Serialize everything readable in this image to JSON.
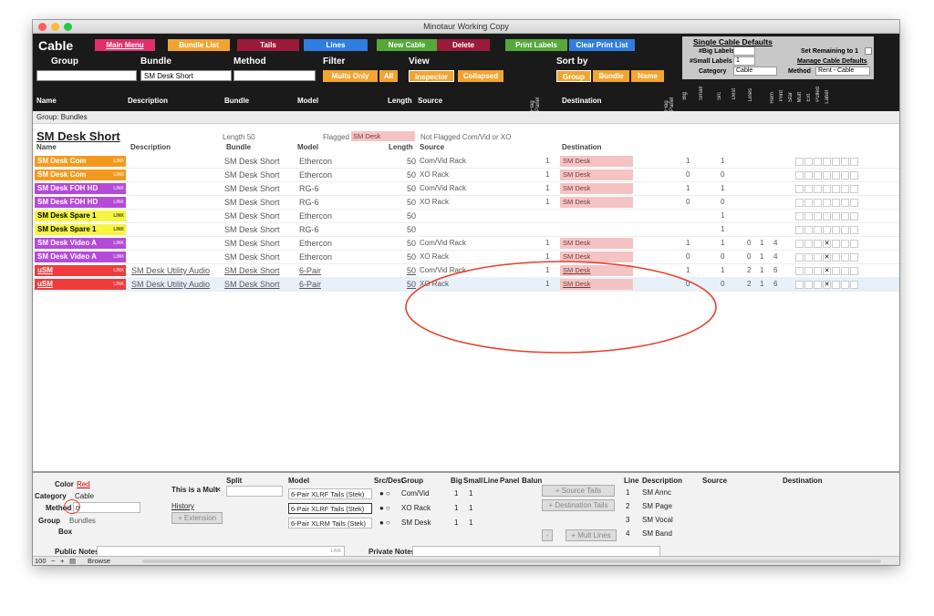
{
  "window": {
    "title": "Minotaur Working Copy"
  },
  "header": {
    "cable_title": "Cable",
    "main_menu": "Main Menu",
    "bundle_list": "Bundle List",
    "tails": "Tails",
    "lines": "Lines",
    "new_cable": "New Cable",
    "delete": "Delete",
    "print_labels": "Print Labels",
    "clear_print_list": "Clear Print List",
    "group_label": "Group",
    "bundle_label": "Bundle",
    "method_label": "Method",
    "filter_label": "Filter",
    "view_label": "View",
    "bundle_value": "SM Desk Short",
    "mults_only": "Mults Only",
    "all": "All",
    "inspector": "Inspector",
    "collapsed": "Collapsed",
    "sort_by": "Sort by",
    "sort_group": "Group",
    "sort_bundle": "Bundle",
    "sort_name": "Name",
    "defaults": {
      "title": "Single Cable Defaults",
      "big_labels": "#Big Labels",
      "small_labels": "#Small Labels",
      "small_value": "1",
      "category_label": "Category",
      "category_value": "Cable",
      "set_remaining": "Set Remaining to 1",
      "manage": "Manage Cable Defaults",
      "method_label": "Method",
      "method_value": "Rent - Cable"
    },
    "cols": {
      "name": "Name",
      "description": "Description",
      "bundle": "Bundle",
      "model": "Model",
      "length": "Length",
      "source": "Source",
      "destination": "Destination"
    },
    "vcols": [
      "Flag Panel",
      "Flag Panel",
      "Big",
      "Small",
      "Src",
      "Dest",
      "Lines",
      "Rem",
      "Print",
      "Star",
      "Mult",
      "Ext",
      "Pulled",
      "Label"
    ]
  },
  "group_bar": "Group: Bundles",
  "bundle": {
    "title": "SM Desk Short",
    "length": "Length 50",
    "flagged_label": "Flagged",
    "flagged_value": "SM Desk",
    "not_flagged": "Not Flagged  Com/Vid or XO"
  },
  "sub_cols": {
    "name": "Name",
    "description": "Description",
    "bundle": "Bundle",
    "model": "Model",
    "length": "Length",
    "source": "Source",
    "destination": "Destination"
  },
  "link": "LINK",
  "rows": [
    {
      "name": "SM Desk Com",
      "color": "#f39a1e",
      "desc": "",
      "bundle": "SM Desk Short",
      "model": "Ethercon",
      "len": "50",
      "src": "Com/Vid Rack",
      "p1": "1",
      "dest": "SM Desk",
      "p2": "1",
      "big": "",
      "small": "1",
      "s": "",
      "d": "",
      "l": "",
      "x": false
    },
    {
      "name": "SM Desk Com",
      "color": "#f39a1e",
      "desc": "",
      "bundle": "SM Desk Short",
      "model": "Ethercon",
      "len": "50",
      "src": "XO Rack",
      "p1": "1",
      "dest": "SM Desk",
      "p2": "0",
      "big": "",
      "small": "0",
      "s": "",
      "d": "",
      "l": "",
      "x": false
    },
    {
      "name": "SM Desk FOH HD",
      "color": "#b44bd8",
      "desc": "",
      "bundle": "SM Desk Short",
      "model": "RG-6",
      "len": "50",
      "src": "Com/Vid Rack",
      "p1": "1",
      "dest": "SM Desk",
      "p2": "1",
      "big": "",
      "small": "1",
      "s": "",
      "d": "",
      "l": "",
      "x": false
    },
    {
      "name": "SM Desk FOH HD",
      "color": "#b44bd8",
      "desc": "",
      "bundle": "SM Desk Short",
      "model": "RG-6",
      "len": "50",
      "src": "XO Rack",
      "p1": "1",
      "dest": "SM Desk",
      "p2": "0",
      "big": "",
      "small": "0",
      "s": "",
      "d": "",
      "l": "",
      "x": false
    },
    {
      "name": "SM Desk Spare 1",
      "color": "#f5f542",
      "desc": "",
      "bundle": "SM Desk Short",
      "model": "Ethercon",
      "len": "50",
      "src": "",
      "p1": "",
      "dest": "",
      "p2": "",
      "big": "",
      "small": "1",
      "s": "",
      "d": "",
      "l": "",
      "x": false
    },
    {
      "name": "SM Desk Spare 1",
      "color": "#f5f542",
      "desc": "",
      "bundle": "SM Desk Short",
      "model": "RG-6",
      "len": "50",
      "src": "",
      "p1": "",
      "dest": "",
      "p2": "",
      "big": "",
      "small": "1",
      "s": "",
      "d": "",
      "l": "",
      "x": false
    },
    {
      "name": "SM Desk Video A",
      "color": "#b44bd8",
      "desc": "",
      "bundle": "SM Desk Short",
      "model": "Ethercon",
      "len": "50",
      "src": "Com/Vid Rack",
      "p1": "1",
      "dest": "SM Desk",
      "p2": "1",
      "big": "",
      "small": "1",
      "s": "0",
      "d": "1",
      "l": "4",
      "x": true
    },
    {
      "name": "SM Desk Video A",
      "color": "#b44bd8",
      "desc": "",
      "bundle": "SM Desk Short",
      "model": "Ethercon",
      "len": "50",
      "src": "XO Rack",
      "p1": "1",
      "dest": "SM Desk",
      "p2": "0",
      "big": "",
      "small": "0",
      "s": "0",
      "d": "1",
      "l": "4",
      "x": true
    },
    {
      "name": "uSM",
      "color": "#ef3b3b",
      "desc": "SM Desk Utility Audio",
      "bundle": "SM Desk Short",
      "model": "6-Pair",
      "len": "50",
      "src": "Com/Vid Rack",
      "p1": "1",
      "dest": "SM Desk",
      "p2": "1",
      "big": "",
      "small": "1",
      "s": "2",
      "d": "1",
      "l": "6",
      "x": true
    },
    {
      "name": "uSM",
      "color": "#ef3b3b",
      "desc": "SM Desk Utility Audio",
      "bundle": "SM Desk Short",
      "model": "6-Pair",
      "len": "50",
      "src": "XO Rack",
      "p1": "1",
      "dest": "SM Desk",
      "p2": "0",
      "big": "",
      "small": "0",
      "s": "2",
      "d": "1",
      "l": "6",
      "x": true
    }
  ],
  "footer": {
    "color_label": "Color",
    "color_value": "Red",
    "category_label": "Category",
    "category_value": "Cable",
    "method_label": "Method",
    "method_value": "0",
    "group_label": "Group",
    "group_value": "Bundles",
    "box_label": "Box",
    "mult_text": "This is a Mult",
    "mult_x": "✕",
    "history": "History",
    "extension": "+ Extension",
    "split": "Split",
    "model_h": "Model",
    "srcdest_h": "Src/Dest",
    "group_h": "Group",
    "big_h": "Big",
    "small_h": "Small",
    "line_h": "Line",
    "panel_h": "Panel",
    "balun_h": "Balun",
    "tails": [
      {
        "model": "6-Pair XLRF Tails (Stek)",
        "group": "Com/Vid",
        "big": "1",
        "small": "1"
      },
      {
        "model": "6-Pair XLRF Tails (Stek)",
        "group": "XO Rack",
        "big": "1",
        "small": "1"
      },
      {
        "model": "6-Pair XLRM Tails (Stek)",
        "group": "SM Desk",
        "big": "1",
        "small": "1"
      }
    ],
    "source_tails": "+ Source Tails",
    "dest_tails": "+ Destination Tails",
    "minus": "-",
    "mult_lines": "+ Mult Lines",
    "line_h2": "Line",
    "desc_h": "Description",
    "source_h": "Source",
    "dest_h": "Destination",
    "lines": [
      {
        "n": "1",
        "d": "SM Annc"
      },
      {
        "n": "2",
        "d": "SM Page"
      },
      {
        "n": "3",
        "d": "SM Vocal"
      },
      {
        "n": "4",
        "d": "SM Band"
      }
    ],
    "public_notes": "Public Notes",
    "private_notes": "Private Notes"
  },
  "status": {
    "zoom": "100",
    "mode": "Browse"
  }
}
